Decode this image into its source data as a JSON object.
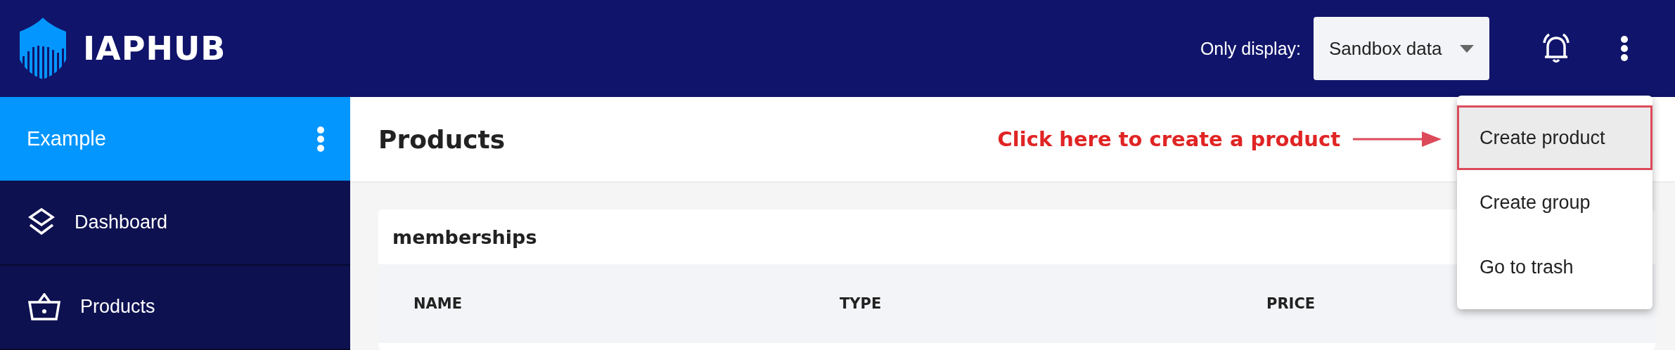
{
  "brand": {
    "name": "IAPHUB"
  },
  "header": {
    "filter_label": "Only display:",
    "filter_select": {
      "value": "Sandbox data"
    }
  },
  "sidebar": {
    "app": {
      "name": "Example"
    },
    "items": [
      {
        "label": "Dashboard"
      },
      {
        "label": "Products"
      }
    ]
  },
  "page": {
    "title": "Products",
    "annotation": "Click here to create a product"
  },
  "group_card": {
    "title": "memberships",
    "columns": [
      "NAME",
      "TYPE",
      "PRICE"
    ]
  },
  "menu": {
    "items": [
      {
        "label": "Create product",
        "selected": true
      },
      {
        "label": "Create group",
        "selected": false
      },
      {
        "label": "Go to trash",
        "selected": false
      }
    ]
  }
}
